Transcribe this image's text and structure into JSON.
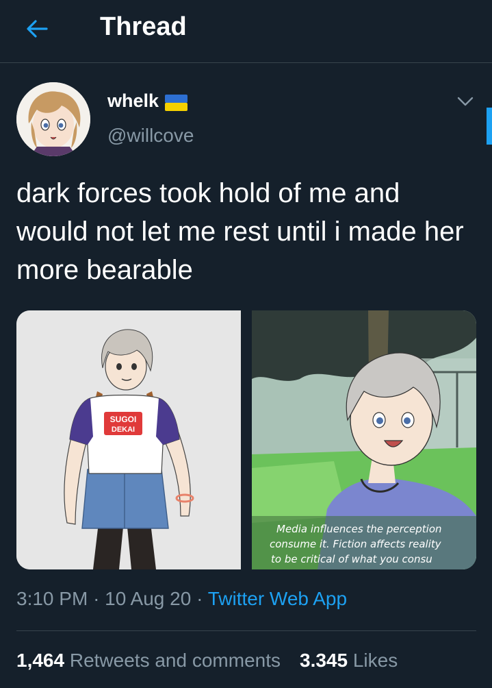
{
  "header": {
    "title": "Thread",
    "back_icon": "arrow-left-icon"
  },
  "author": {
    "display_name": "whelk",
    "flag_icon": "ukraine-flag-icon",
    "handle": "@willcove",
    "menu_icon": "chevron-down-icon"
  },
  "tweet": {
    "text": "dark forces took hold of me and would not let me rest until i made her more bearable"
  },
  "media": {
    "left_shirt_text_line1": "SUGOI",
    "left_shirt_text_line2": "DEKAI",
    "right_caption_line1": "Media influences the perception",
    "right_caption_line2": "consume it. Fiction affects reality",
    "right_caption_line3": "to be critical of what you consu"
  },
  "meta": {
    "time": "3:10 PM",
    "separator": "·",
    "date": "10 Aug 20",
    "source": "Twitter Web App"
  },
  "stats": {
    "retweets_count": "1,464",
    "retweets_label": "Retweets and comments",
    "likes_count": "3.345",
    "likes_label": "Likes"
  },
  "colors": {
    "background": "#15202b",
    "accent": "#1da1f2",
    "secondary_text": "#8899a6",
    "divider": "#38444d"
  }
}
